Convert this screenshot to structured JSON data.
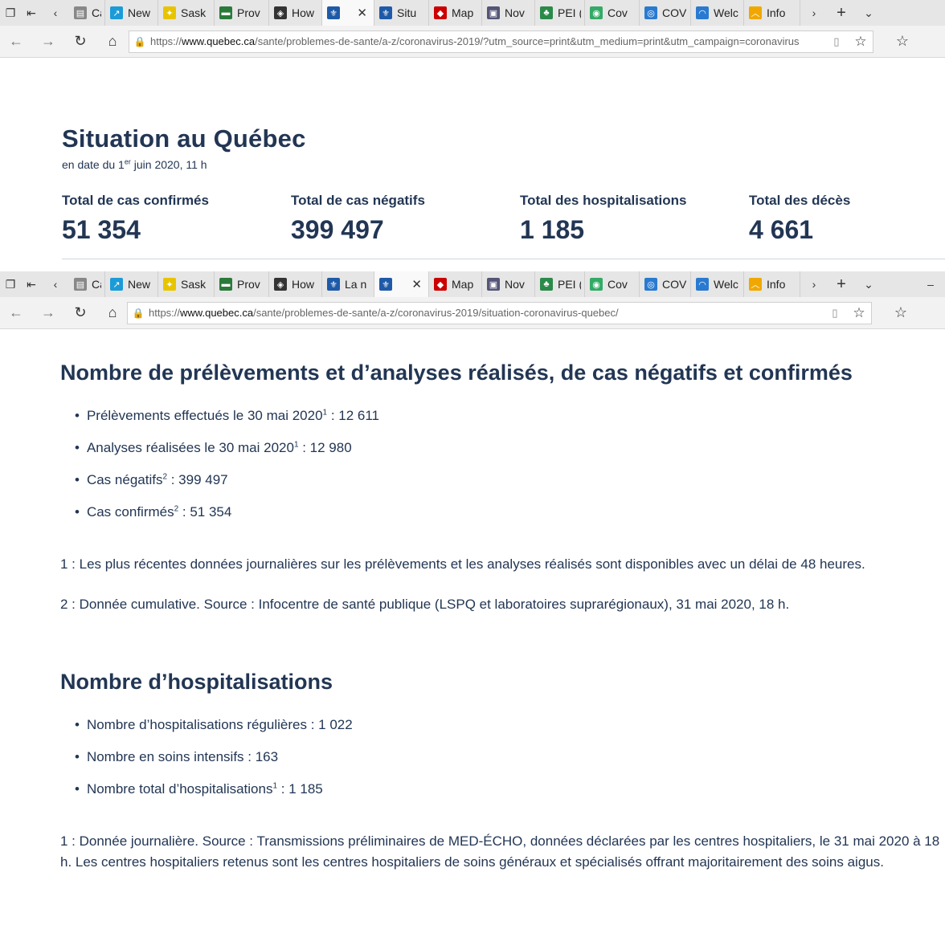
{
  "browser_top": {
    "tabs": [
      {
        "label": "Case",
        "fav": "#888",
        "icon": "generic"
      },
      {
        "label": "New",
        "fav": "#1b9bd7",
        "icon": "chart"
      },
      {
        "label": "Sask",
        "fav": "#e8c400",
        "icon": "sask"
      },
      {
        "label": "Prov",
        "fav": "#2a7a3a",
        "icon": "ont"
      },
      {
        "label": "How",
        "fav": "#333",
        "icon": "shield"
      },
      {
        "label": "",
        "fav": "#1f5aa8",
        "icon": "quebec",
        "active": true
      },
      {
        "label": "Situ",
        "fav": "#1f5aa8",
        "icon": "quebec"
      },
      {
        "label": "Map",
        "fav": "#c00",
        "icon": "map"
      },
      {
        "label": "Nov",
        "fav": "#557",
        "icon": "nov"
      },
      {
        "label": "PEI (",
        "fav": "#2a8a4a",
        "icon": "pei"
      },
      {
        "label": "Cov",
        "fav": "#3a6",
        "icon": "globe"
      },
      {
        "label": "COV",
        "fav": "#2a7ad0",
        "icon": "cov"
      },
      {
        "label": "Welc",
        "fav": "#2a7ad0",
        "icon": "welc"
      },
      {
        "label": "Info",
        "fav": "#f0a800",
        "icon": "info"
      }
    ],
    "url_prefix": "https://",
    "url_host": "www.quebec.ca",
    "url_path": "/sante/problemes-de-sante/a-z/coronavirus-2019/?utm_source=print&utm_medium=print&utm_campaign=coronavirus"
  },
  "browser_mid": {
    "tabs": [
      {
        "label": "Case",
        "fav": "#888",
        "icon": "generic"
      },
      {
        "label": "New",
        "fav": "#1b9bd7",
        "icon": "chart"
      },
      {
        "label": "Sask",
        "fav": "#e8c400",
        "icon": "sask"
      },
      {
        "label": "Prov",
        "fav": "#2a7a3a",
        "icon": "ont"
      },
      {
        "label": "How",
        "fav": "#333",
        "icon": "shield"
      },
      {
        "label": "La n",
        "fav": "#1f5aa8",
        "icon": "quebec"
      },
      {
        "label": "",
        "fav": "#1f5aa8",
        "icon": "quebec",
        "active": true
      },
      {
        "label": "Map",
        "fav": "#c00",
        "icon": "map"
      },
      {
        "label": "Nov",
        "fav": "#557",
        "icon": "nov"
      },
      {
        "label": "PEI (",
        "fav": "#2a8a4a",
        "icon": "pei"
      },
      {
        "label": "Cov",
        "fav": "#3a6",
        "icon": "globe"
      },
      {
        "label": "COV",
        "fav": "#2a7ad0",
        "icon": "cov"
      },
      {
        "label": "Welc",
        "fav": "#2a7ad0",
        "icon": "welc"
      },
      {
        "label": "Info",
        "fav": "#f0a800",
        "icon": "info"
      }
    ],
    "url_prefix": "https://",
    "url_host": "www.quebec.ca",
    "url_path": "/sante/problemes-de-sante/a-z/coronavirus-2019/situation-coronavirus-quebec/"
  },
  "situation": {
    "title": "Situation au Québec",
    "date_pre": "en date du 1",
    "date_sup": "er",
    "date_post": " juin 2020, 11 h",
    "stats": [
      {
        "label": "Total de cas confirmés",
        "value": "51 354"
      },
      {
        "label": "Total de cas négatifs",
        "value": "399 497"
      },
      {
        "label": "Total des hospitalisations",
        "value": "1 185"
      },
      {
        "label": "Total des décès",
        "value": "4 661"
      }
    ]
  },
  "analyses": {
    "heading": "Nombre de prélèvements et d’analyses réalisés, de cas négatifs et confirmés",
    "items": [
      {
        "text": "Prélèvements effectués le 30 mai 2020",
        "sup": "1",
        "value": " : 12 611"
      },
      {
        "text": "Analyses réalisées le 30 mai 2020",
        "sup": "1",
        "value": " : 12 980"
      },
      {
        "text": "Cas négatifs",
        "sup": "2",
        "value": " : 399 497"
      },
      {
        "text": "Cas confirmés",
        "sup": "2",
        "value": " : 51 354"
      }
    ],
    "note1": "1 : Les plus récentes données journalières sur les prélèvements et les analyses réalisés sont disponibles avec un délai de 48 heures.",
    "note2": "2 : Donnée cumulative. Source : Infocentre de santé publique (LSPQ et laboratoires suprarégionaux), 31 mai 2020, 18 h."
  },
  "hospital": {
    "heading": "Nombre d’hospitalisations",
    "items": [
      {
        "text": "Nombre d’hospitalisations régulières : 1 022",
        "sup": "",
        "value": ""
      },
      {
        "text": "Nombre en soins intensifs : 163",
        "sup": "",
        "value": ""
      },
      {
        "text": "Nombre total d’hospitalisations",
        "sup": "1",
        "value": " : 1 185"
      }
    ],
    "note": "1 : Donnée journalière. Source : Transmissions préliminaires de MED-ÉCHO, données déclarées par les centres hospitaliers, le 31 mai 2020 à 18 h. Les centres hospitaliers retenus sont les centres hospitaliers de soins généraux et spécialisés offrant majoritairement des soins aigus."
  }
}
